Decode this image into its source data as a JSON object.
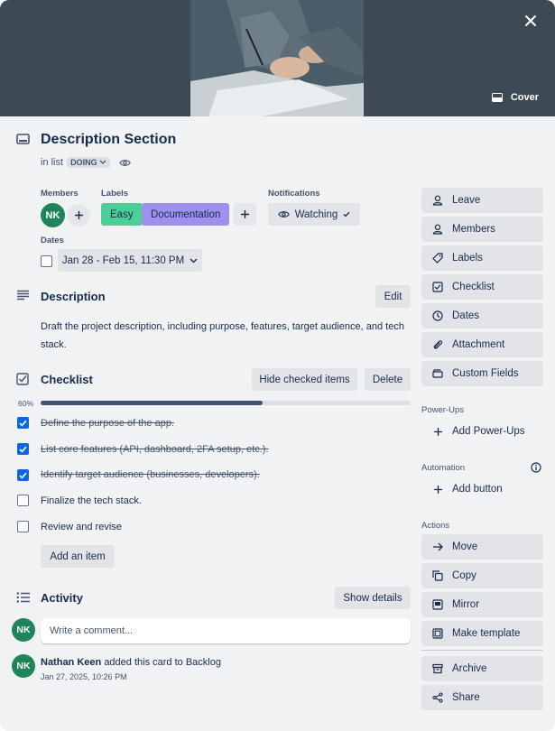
{
  "cover": {
    "button_label": "Cover"
  },
  "card": {
    "title": "Description Section",
    "in_list_prefix": "in list",
    "list_name": "DOING"
  },
  "members": {
    "label": "Members",
    "avatars": [
      "NK"
    ]
  },
  "labels": {
    "label": "Labels",
    "items": [
      {
        "text": "Easy",
        "color": "#4bce97"
      },
      {
        "text": "Documentation",
        "color": "#9f8fef"
      }
    ]
  },
  "notifications": {
    "label": "Notifications",
    "button": "Watching"
  },
  "dates": {
    "label": "Dates",
    "value": "Jan 28 - Feb 15, 11:30 PM"
  },
  "description": {
    "heading": "Description",
    "edit": "Edit",
    "text": "Draft the project description, including purpose, features, target audience, and tech stack."
  },
  "checklist": {
    "heading": "Checklist",
    "hide_button": "Hide checked items",
    "delete_button": "Delete",
    "progress_label": "60%",
    "progress": 0.6,
    "items": [
      {
        "text": "Define the purpose of the app.",
        "checked": true
      },
      {
        "text": "List core features (API, dashboard, 2FA setup, etc.).",
        "checked": true
      },
      {
        "text": "Identify target audience (businesses, developers).",
        "checked": true
      },
      {
        "text": "Finalize the tech stack.",
        "checked": false
      },
      {
        "text": "Review and revise",
        "checked": false
      }
    ],
    "add_item": "Add an item"
  },
  "activity": {
    "heading": "Activity",
    "show_details": "Show details",
    "comment_placeholder": "Write a comment...",
    "entries": [
      {
        "avatar": "NK",
        "user": "Nathan Keen",
        "action": "added this card to Backlog",
        "time": "Jan 27, 2025, 10:26 PM"
      }
    ],
    "current_user_avatar": "NK"
  },
  "sidebar": {
    "actions_top": [
      "Leave",
      "Members",
      "Labels",
      "Checklist",
      "Dates",
      "Attachment",
      "Custom Fields"
    ],
    "powerups_heading": "Power-Ups",
    "add_powerups": "Add Power-Ups",
    "automation_heading": "Automation",
    "add_button": "Add button",
    "actions_heading": "Actions",
    "actions": [
      "Move",
      "Copy",
      "Mirror",
      "Make template"
    ],
    "archive": "Archive",
    "share": "Share"
  },
  "colors": {
    "accent": "#0c66e4",
    "avatar": "#1f845a",
    "progress": "#44546f"
  }
}
